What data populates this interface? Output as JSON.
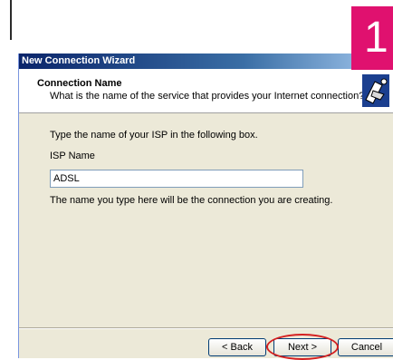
{
  "window": {
    "title": "New Connection Wizard"
  },
  "header": {
    "title": "Connection Name",
    "subtitle": "What is the name of the service that provides your Internet connection?"
  },
  "body": {
    "instruction": "Type the name of your ISP in the following box.",
    "isp_label": "ISP Name",
    "isp_value": "ADSL",
    "note": "The name you type here will be the connection you are creating."
  },
  "buttons": {
    "back": "< Back",
    "next": "Next >",
    "cancel": "Cancel"
  },
  "step_badge": "1",
  "colors": {
    "titlebar": "#0a246a",
    "badge": "#e0116f",
    "highlight": "#d42020"
  }
}
